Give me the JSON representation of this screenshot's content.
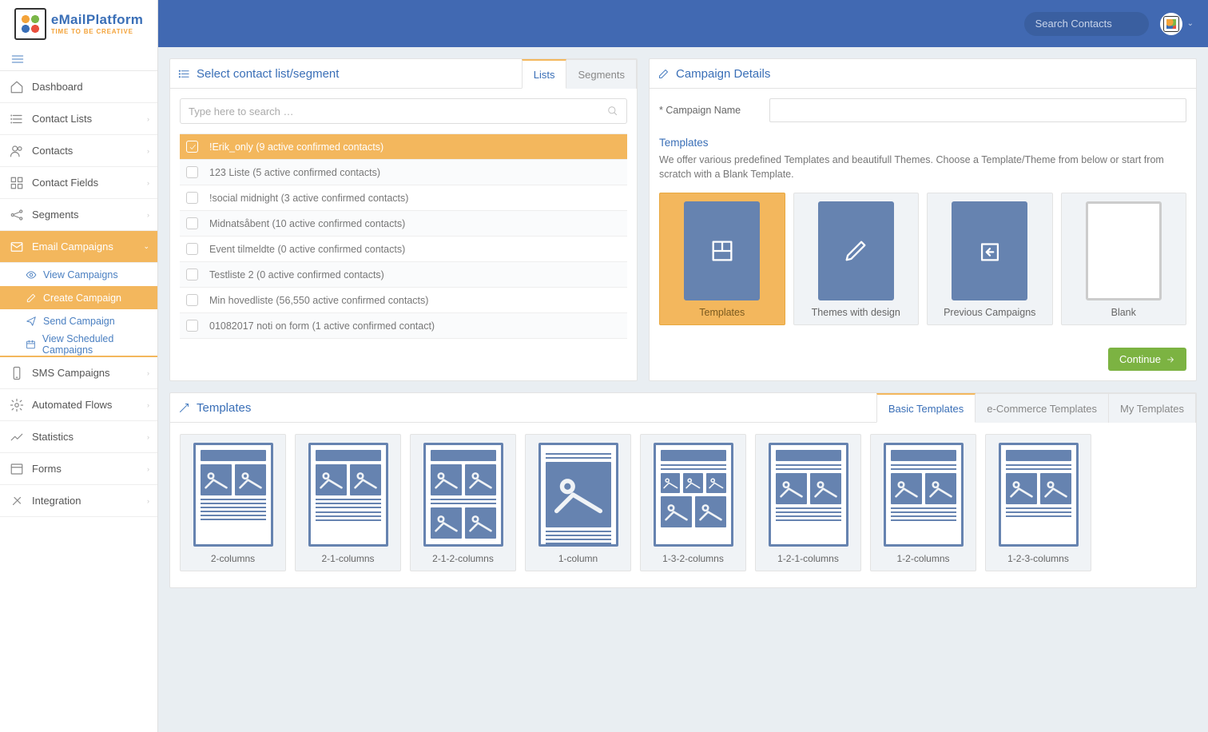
{
  "brand": {
    "name": "eMailPlatform",
    "tagline": "TIME TO BE CREATIVE"
  },
  "search": {
    "placeholder": "Search Contacts"
  },
  "sidebar": {
    "items": [
      {
        "label": "Dashboard"
      },
      {
        "label": "Contact Lists"
      },
      {
        "label": "Contacts"
      },
      {
        "label": "Contact Fields"
      },
      {
        "label": "Segments"
      },
      {
        "label": "Email Campaigns"
      },
      {
        "label": "SMS Campaigns"
      },
      {
        "label": "Automated Flows"
      },
      {
        "label": "Statistics"
      },
      {
        "label": "Forms"
      },
      {
        "label": "Integration"
      }
    ],
    "subitems": [
      {
        "label": "View Campaigns"
      },
      {
        "label": "Create Campaign"
      },
      {
        "label": "Send Campaign"
      },
      {
        "label": "View Scheduled Campaigns"
      }
    ]
  },
  "contact_panel": {
    "title": "Select contact list/segment",
    "tabs": [
      "Lists",
      "Segments"
    ],
    "search_placeholder": "Type here to search …",
    "rows": [
      "!Erik_only (9 active confirmed contacts)",
      "123 Liste (5 active confirmed contacts)",
      "!social midnight (3 active confirmed contacts)",
      "Midnatsåbent (10 active confirmed contacts)",
      "Event tilmeldte (0 active confirmed contacts)",
      "Testliste 2 (0 active confirmed contacts)",
      "Min hovedliste (56,550 active confirmed contacts)",
      "01082017 noti on form (1 active confirmed contact)"
    ]
  },
  "details": {
    "title": "Campaign Details",
    "name_label": "* Campaign Name",
    "templates_title": "Templates",
    "templates_desc": "We offer various predefined Templates and beautifull Themes. Choose a Template/Theme from below or start from scratch with a Blank Template.",
    "cards": [
      "Templates",
      "Themes with design",
      "Previous Campaigns",
      "Blank"
    ],
    "continue": "Continue"
  },
  "templates_panel": {
    "title": "Templates",
    "tabs": [
      "Basic Templates",
      "e-Commerce Templates",
      "My Templates"
    ],
    "items": [
      "2-columns",
      "2-1-columns",
      "2-1-2-columns",
      "1-column",
      "1-3-2-columns",
      "1-2-1-columns",
      "1-2-columns",
      "1-2-3-columns"
    ]
  }
}
